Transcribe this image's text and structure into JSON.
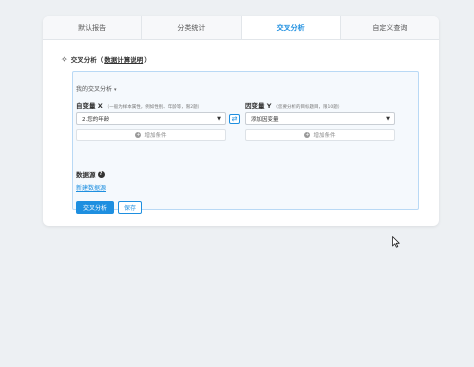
{
  "tabs": [
    {
      "label": "默认报告",
      "active": false
    },
    {
      "label": "分类统计",
      "active": false
    },
    {
      "label": "交叉分析",
      "active": true
    },
    {
      "label": "自定义查询",
      "active": false
    }
  ],
  "section": {
    "title_prefix": "交叉分析（",
    "link": "数据计算说明",
    "title_suffix": "）"
  },
  "panel": {
    "title": "我的交叉分析",
    "independent": {
      "label": "自变量 X",
      "hint": "（一般为样本属性，例如性别、年龄等，限2题）",
      "selected": "2.您的年龄",
      "add_label": "增加条件"
    },
    "dependent": {
      "label": "因变量 Y",
      "hint": "（您要分析的目标题目，限10题）",
      "selected": "添加因变量",
      "add_label": "增加条件"
    },
    "datasource_label": "数据源",
    "new_datasource": "新建数据源",
    "analyze_button": "交叉分析",
    "save_button": "保存"
  },
  "colors": {
    "accent": "#1e8fe0",
    "panel_border": "#b9d9f5",
    "background": "#edf0f3"
  }
}
